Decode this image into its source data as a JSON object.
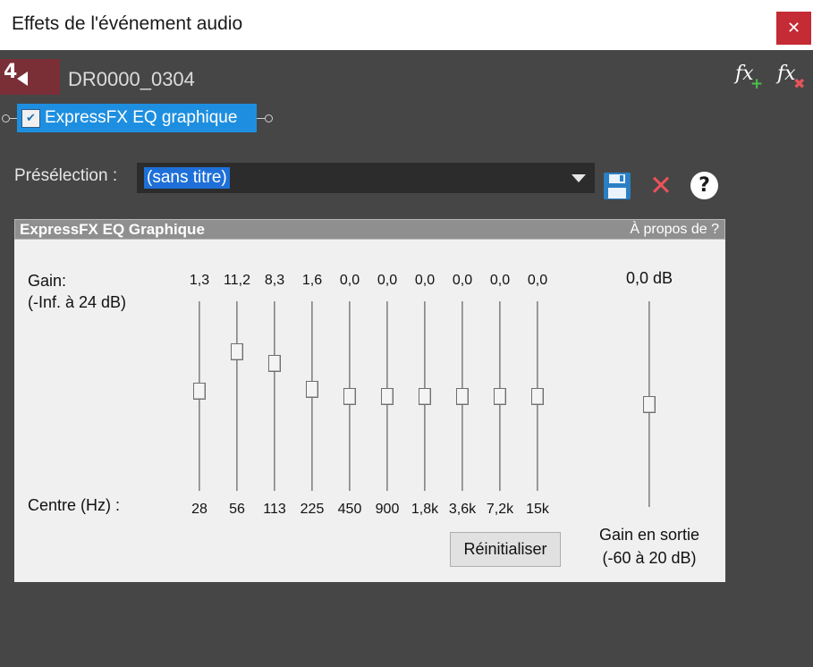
{
  "window": {
    "title": "Effets de l'événement audio",
    "close_glyph": "✕"
  },
  "event": {
    "name": "DR0000_0304",
    "icon": "audio-event-icon",
    "icon_glyph": "4"
  },
  "chain": {
    "plugin_label": "ExpressFX EQ graphique",
    "enabled": true
  },
  "preset": {
    "label": "Présélection :",
    "value": "(sans titre)"
  },
  "panel": {
    "title": "ExpressFX EQ Graphique",
    "about": "À propos de ?",
    "gain_label_line1": "Gain:",
    "gain_label_line2": "(-Inf. à 24 dB)",
    "center_label": "Centre (Hz) :",
    "reset_label": "Réinitialiser",
    "gain_min_db": -24,
    "gain_max_db": 24,
    "bands": [
      {
        "freq": "28",
        "gain_text": "1,3",
        "gain": 1.3
      },
      {
        "freq": "56",
        "gain_text": "11,2",
        "gain": 11.2
      },
      {
        "freq": "113",
        "gain_text": "8,3",
        "gain": 8.3
      },
      {
        "freq": "225",
        "gain_text": "1,6",
        "gain": 1.6
      },
      {
        "freq": "450",
        "gain_text": "0,0",
        "gain": 0
      },
      {
        "freq": "900",
        "gain_text": "0,0",
        "gain": 0
      },
      {
        "freq": "1,8k",
        "gain_text": "0,0",
        "gain": 0
      },
      {
        "freq": "3,6k",
        "gain_text": "0,0",
        "gain": 0
      },
      {
        "freq": "7,2k",
        "gain_text": "0,0",
        "gain": 0
      },
      {
        "freq": "15k",
        "gain_text": "0,0",
        "gain": 0
      }
    ],
    "output": {
      "value_text": "0,0 dB",
      "label_line1": "Gain en sortie",
      "label_line2": "(-60 à 20 dB)",
      "level": 0.5
    }
  },
  "colors": {
    "background": "#464646",
    "accent": "#1e8fe0",
    "close": "#c42b34",
    "event_icon_bg": "#7a2f37"
  }
}
